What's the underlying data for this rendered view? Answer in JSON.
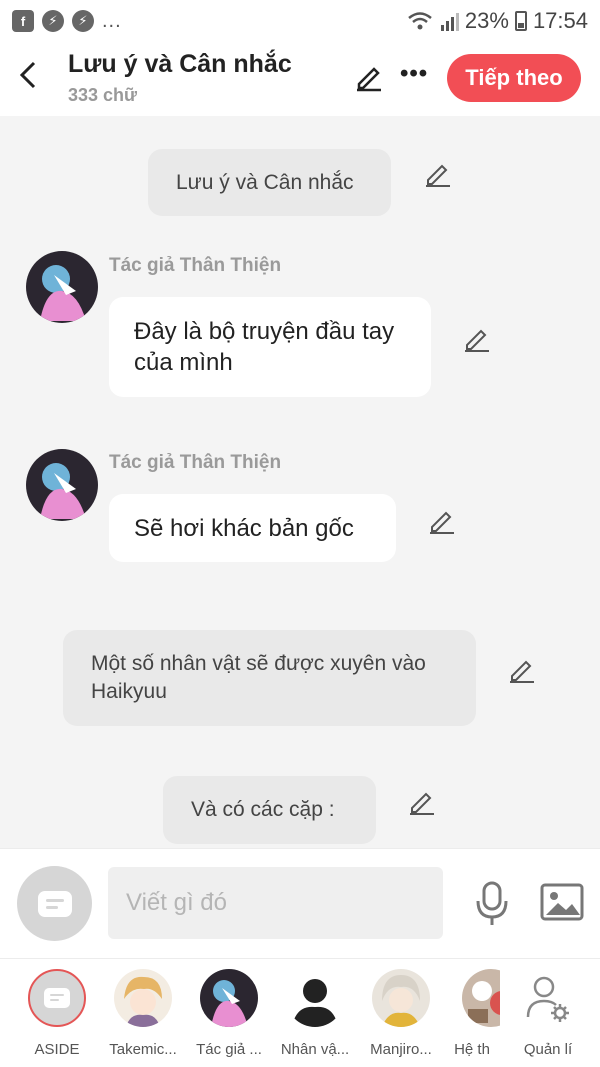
{
  "status_bar": {
    "dots": "...",
    "battery": "23%",
    "time": "17:54"
  },
  "header": {
    "title": "Lưu ý và Cân nhắc",
    "word_count": "333 chữ",
    "next_label": "Tiếp theo"
  },
  "messages": [
    {
      "type": "narration",
      "text": "Lưu ý và Cân nhắc"
    },
    {
      "type": "character",
      "speaker": "Tác giả Thân Thiện",
      "text": "Đây là bộ truyện đầu tay của mình"
    },
    {
      "type": "character",
      "speaker": "Tác giả Thân Thiện",
      "text": "Sẽ hơi khác bản gốc"
    },
    {
      "type": "narration",
      "text": "Một số nhân vật sẽ được xuyên vào Haikyuu"
    },
    {
      "type": "narration",
      "text": "Và có các cặp :"
    }
  ],
  "composer": {
    "placeholder": "Viết gì đó"
  },
  "characters": [
    {
      "label": "ASIDE"
    },
    {
      "label": "Takemic..."
    },
    {
      "label": "Tác giả ..."
    },
    {
      "label": "Nhân vậ..."
    },
    {
      "label": "Manjiro..."
    },
    {
      "label": "Hệ th"
    },
    {
      "label": "Quản lí"
    }
  ],
  "colors": {
    "accent": "#f24e55",
    "background": "#f4f4f4",
    "narration_bubble": "#e9e9e9",
    "character_bubble": "#ffffff"
  }
}
